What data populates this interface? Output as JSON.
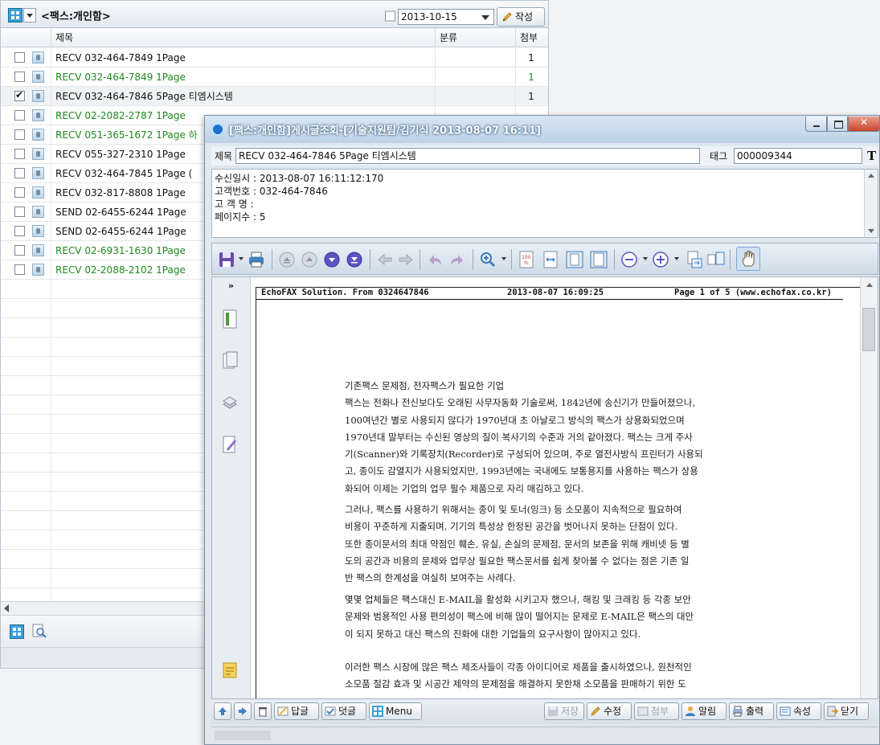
{
  "list": {
    "folder_title": "<팩스:개인함>",
    "date_value": "2013-10-15",
    "write_label": "작성",
    "columns": {
      "subject": "제목",
      "category": "분류",
      "attach": "첨부"
    },
    "rows": [
      {
        "subject": "RECV 032-464-7849  1Page",
        "count": "1",
        "color": "black",
        "checked": false,
        "selected": false
      },
      {
        "subject": "RECV 032-464-7849  1Page",
        "count": "1",
        "color": "green",
        "checked": false,
        "selected": false
      },
      {
        "subject": "RECV 032-464-7846 5Page 티엠시스템",
        "count": "1",
        "color": "black",
        "checked": true,
        "selected": true
      },
      {
        "subject": "RECV 02-2082-2787  1Page",
        "count": "",
        "color": "green",
        "checked": false,
        "selected": false
      },
      {
        "subject": "RECV 051-365-1672 1Page 하",
        "count": "",
        "color": "green",
        "checked": false,
        "selected": false
      },
      {
        "subject": "RECV 055-327-2310  1Page",
        "count": "",
        "color": "black",
        "checked": false,
        "selected": false
      },
      {
        "subject": "RECV 032-464-7845 1Page (",
        "count": "",
        "color": "black",
        "checked": false,
        "selected": false
      },
      {
        "subject": "RECV 032-817-8808  1Page",
        "count": "",
        "color": "black",
        "checked": false,
        "selected": false
      },
      {
        "subject": "SEND 02-6455-6244  1Page",
        "count": "",
        "color": "black",
        "checked": false,
        "selected": false
      },
      {
        "subject": "SEND 02-6455-6244  1Page",
        "count": "",
        "color": "black",
        "checked": false,
        "selected": false
      },
      {
        "subject": "RECV 02-6931-1630  1Page",
        "count": "",
        "color": "green",
        "checked": false,
        "selected": false
      },
      {
        "subject": "RECV 02-2088-2102  1Page",
        "count": "",
        "color": "green",
        "checked": false,
        "selected": false
      }
    ]
  },
  "viewer": {
    "title": "[팩스:개인함]게시글조회-[기술지원팀/김기식 2013-08-07 16:11]",
    "subject_label": "제목",
    "subject_value": "RECV 032-464-7846 5Page 티엠시스템",
    "tag_label": "태그",
    "tag_value": "000009344",
    "t_label": "T",
    "info_lines": [
      "수신일시 : 2013-08-07 16:11:12:170",
      "고객번호 : 032-464-7846",
      "고 객 명 :",
      "페이지수 : 5"
    ],
    "rail_collapse": "»",
    "fax_header": {
      "left": "EchoFAX Solution. From 0324647846",
      "mid": "2013-08-07 16:09:25",
      "right": "Page 1 of 5 (www.echofax.co.kr)"
    },
    "paragraphs": [
      [
        "기존팩스 문제점, 전자팩스가 필요한 기업",
        "팩스는 전화나 전신보다도 오래된 사무자동화 기술로써, 1842년에 송신기가 만들어졌으나,",
        "100여년간 별로 사용되지 않다가 1970년대 초 아날로그 방식의 팩스가 상용화되었으며",
        "1970년대 말부터는 수신된 영상의 질이 복사기의 수준과 거의 같아졌다. 팩스는 크게 주사",
        "기(Scanner)와 기록장치(Recorder)로 구성되어 있으며, 주로 열전사방식 프린터가 사용되",
        "고, 종이도 감열지가 사용되었지만, 1993년에는 국내에도 보통용지를 사용하는 팩스가 상용",
        "화되어 이제는 기업의 업무 필수 제품으로 자리 매김하고 있다."
      ],
      [
        "그러나, 팩스를 사용하기 위해서는 종이 및 토너(잉크) 등 소모품이 지속적으로 필요하여",
        "비용이 꾸준하게 지출되며, 기기의 특성상 한정된 공간을 벗어나지 못하는 단점이 있다.",
        "또한 종이문서의 최대 약점인 훼손, 유실, 손실의 문제점, 문서의 보존을 위해 캐비넷 등 별",
        "도의 공간과 비용의 문제와 업무상 필요한 팩스문서를 쉽게 찾아볼 수 없다는 점은 기존 일",
        "반 팩스의 한계성을 여실히 보여주는 사례다."
      ],
      [
        "몇몇 업체들은 팩스대신 E-MAIL을 활성화 시키고자 했으나, 해킹 및 크래킹 등 각종 보안",
        "문제와 범용적인 사용 편의성이 팩스에 비해 많이 떨어지는 문제로 E-MAIL은 팩스의 대안",
        "이 되지 못하고 대신 팩스의 진화에 대한 기업들의 요구사항이 많아지고 있다."
      ],
      [
        "이러한 팩스 시장에 많은 팩스 제조사들이 각종 아이디어로 제품을 출시하였으나, 원천적인",
        "소모품 절감 효과 및 시공간 제약의 문제점을 해결하지 못한채 소모품을 판매하기 위한 도"
      ]
    ],
    "bottom_buttons": {
      "reply": "답글",
      "comment": "덧글",
      "menu": "Menu",
      "save": "저장",
      "edit": "수정",
      "attach": "첨부",
      "notify": "알림",
      "print": "출력",
      "props": "속성",
      "close": "닫기"
    }
  },
  "colors": {
    "green_text": "#1e8a1e",
    "accent_blue": "#2a7fd0",
    "title_blue": "#bdd2e6"
  }
}
